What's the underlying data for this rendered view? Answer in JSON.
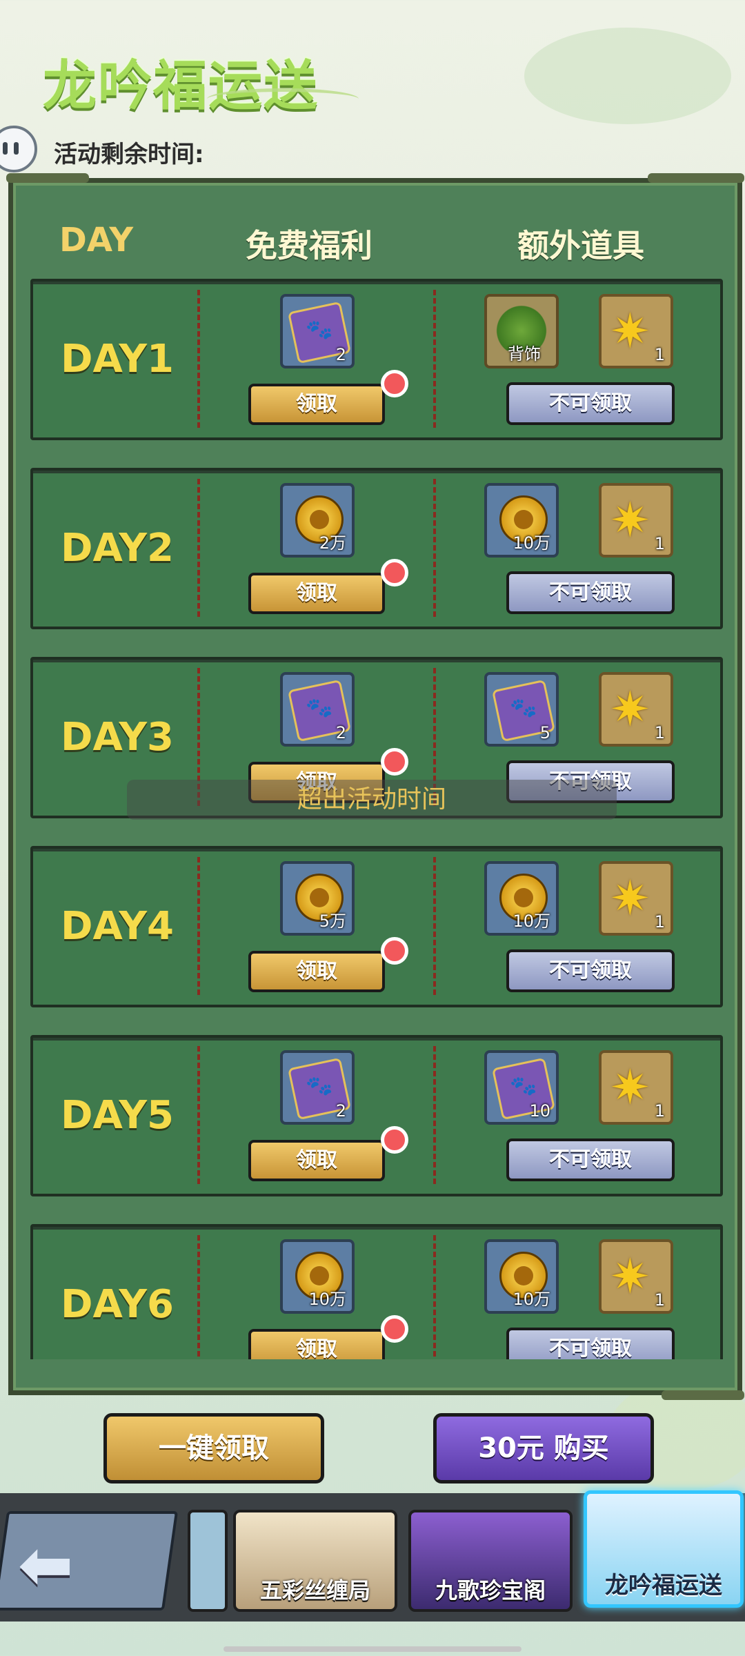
{
  "title": "龙吟福运送",
  "countdown_label": "活动剩余时间:",
  "headers": {
    "day": "DAY",
    "free": "免费福利",
    "extra": "额外道具"
  },
  "days": [
    {
      "label": "DAY1",
      "free": {
        "icon": "purple-ticket-icon",
        "qty": "2"
      },
      "extra": [
        {
          "icon": "plant-backpiece-icon",
          "qty": "背饰"
        },
        {
          "icon": "gold-star-icon",
          "qty": "1"
        }
      ]
    },
    {
      "label": "DAY2",
      "free": {
        "icon": "gold-coin-icon",
        "qty": "2万"
      },
      "extra": [
        {
          "icon": "gold-coin-icon",
          "qty": "10万"
        },
        {
          "icon": "gold-star-icon",
          "qty": "1"
        }
      ]
    },
    {
      "label": "DAY3",
      "free": {
        "icon": "purple-ticket-icon",
        "qty": "2"
      },
      "extra": [
        {
          "icon": "purple-ticket-icon",
          "qty": "5"
        },
        {
          "icon": "gold-star-icon",
          "qty": "1"
        }
      ]
    },
    {
      "label": "DAY4",
      "free": {
        "icon": "gold-coin-icon",
        "qty": "5万"
      },
      "extra": [
        {
          "icon": "gold-coin-icon",
          "qty": "10万"
        },
        {
          "icon": "gold-star-icon",
          "qty": "1"
        }
      ]
    },
    {
      "label": "DAY5",
      "free": {
        "icon": "purple-ticket-icon",
        "qty": "2"
      },
      "extra": [
        {
          "icon": "purple-ticket-icon",
          "qty": "10"
        },
        {
          "icon": "gold-star-icon",
          "qty": "1"
        }
      ]
    },
    {
      "label": "DAY6",
      "free": {
        "icon": "gold-coin-icon",
        "qty": "10万"
      },
      "extra": [
        {
          "icon": "gold-coin-icon",
          "qty": "10万"
        },
        {
          "icon": "gold-star-icon",
          "qty": "1"
        }
      ]
    }
  ],
  "claim_label": "领取",
  "unavailable_label": "不可领取",
  "toast": "超出活动时间",
  "buttons": {
    "claim_all": "一键领取",
    "buy": "30元 购买"
  },
  "tabs": [
    "五彩丝缠局",
    "九歌珍宝阁",
    "龙吟福运送"
  ],
  "colors": {
    "panel": "#3f7a4d",
    "day_text": "#f5db4b",
    "claim": "#e0b24f",
    "buy": "#6e4ec4",
    "badge": "#f2585b",
    "active_tab": "#32c6ff"
  }
}
